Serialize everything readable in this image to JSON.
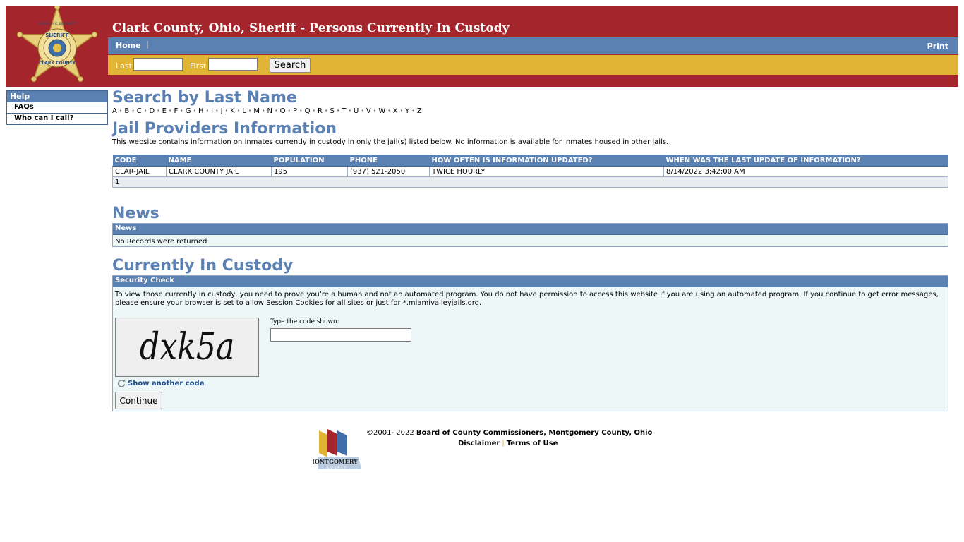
{
  "header": {
    "title": "Clark County, Ohio, Sheriff - Persons Currently In Custody",
    "badge_text": {
      "top": "DEBORAH K. BURCHETT",
      "sheriff": "SHERIFF",
      "bottom": "CLARK COUNTY"
    },
    "colors": {
      "maroon": "#a4262c",
      "blue": "#5b80b2",
      "gold": "#e2b435"
    }
  },
  "nav": {
    "home": "Home",
    "separator": "|",
    "print": "Print"
  },
  "search": {
    "last_label": "Last",
    "first_label": "First",
    "last_value": "",
    "first_value": "",
    "button": "Search"
  },
  "sidebar": {
    "heading": "Help",
    "items": [
      "FAQs",
      "Who can I call?"
    ]
  },
  "search_by_last_name": {
    "heading": "Search by Last Name",
    "letters": [
      "A",
      "B",
      "C",
      "D",
      "E",
      "F",
      "G",
      "H",
      "I",
      "J",
      "K",
      "L",
      "M",
      "N",
      "O",
      "P",
      "Q",
      "R",
      "S",
      "T",
      "U",
      "V",
      "W",
      "X",
      "Y",
      "Z"
    ]
  },
  "providers": {
    "heading": "Jail Providers Information",
    "description": "This website contains information on inmates currently in custody in only the jail(s) listed below. No information is available for inmates housed in other jails.",
    "columns": [
      "CODE",
      "NAME",
      "POPULATION",
      "PHONE",
      "HOW OFTEN IS INFORMATION UPDATED?",
      "WHEN WAS THE LAST UPDATE OF INFORMATION?"
    ],
    "rows": [
      [
        "CLAR-JAIL",
        "CLARK COUNTY JAIL",
        "195",
        "(937) 521-2050",
        "TWICE HOURLY",
        "8/14/2022 3:42:00 AM"
      ]
    ],
    "pager": "1"
  },
  "news": {
    "heading": "News",
    "panel_title": "News",
    "empty": "No Records were returned"
  },
  "custody": {
    "heading": "Currently In Custody",
    "panel_title": "Security Check",
    "message": "To view those currently in custody, you need to prove you’re a human and not an automated program. You do not have permission to access this website if you are using an automated program. If you continue to get error messages, please ensure your browser is set to allow Session Cookies for all sites or just for *.miamivalleyjails.org.",
    "captcha_code": "dxk5a",
    "code_label": "Type the code shown:",
    "code_value": "",
    "another_code": "Show another code",
    "continue": "Continue"
  },
  "footer": {
    "copyright_prefix": "©2001- 2022",
    "copyright_org": "Board of County Commissioners, Montgomery County, Ohio",
    "disclaimer": "Disclaimer",
    "separator": "|",
    "terms": "Terms of Use",
    "logo_text": "MONTGOMERY",
    "logo_subtext": "COUNTY"
  }
}
